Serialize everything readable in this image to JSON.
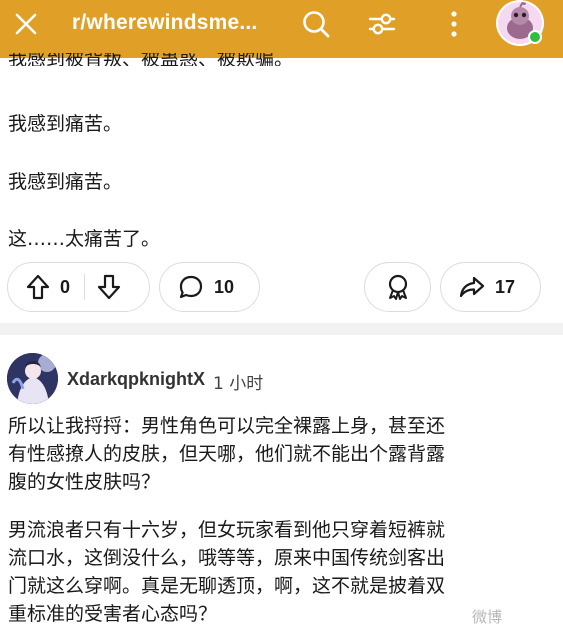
{
  "header": {
    "title": "r/wherewindsme...",
    "icons": [
      "close-icon",
      "search-icon",
      "filter-icon",
      "more-vertical-icon",
      "user-avatar"
    ],
    "accent_color": "#e0a027",
    "online_status_color": "#2fbf3e"
  },
  "post": {
    "cutoff_line": "我感到被背叛、被蛊惑、被欺骗。",
    "paragraphs": [
      "我感到痛苦。",
      "我感到痛苦。",
      "这……太痛苦了。"
    ],
    "actions": {
      "vote_count": "0",
      "comment_count": "10",
      "share_count": "17"
    }
  },
  "comment": {
    "username": "XdarkqpknightX",
    "time": "1 小时",
    "lines": [
      "所以让我捋捋：男性角色可以完全裸露上身，甚至还",
      "有性感撩人的皮肤，但天哪，他们就不能出个露背露",
      "腹的女性皮肤吗？",
      "男流浪者只有十六岁，但女玩家看到他只穿着短裤就",
      "流口水，这倒没什么，哦等等，原来中国传统剑客出",
      "门就这么穿啊。真是无聊透顶，啊，这不就是披着双",
      "重标准的受害者心态吗？"
    ]
  },
  "watermark": "微博"
}
